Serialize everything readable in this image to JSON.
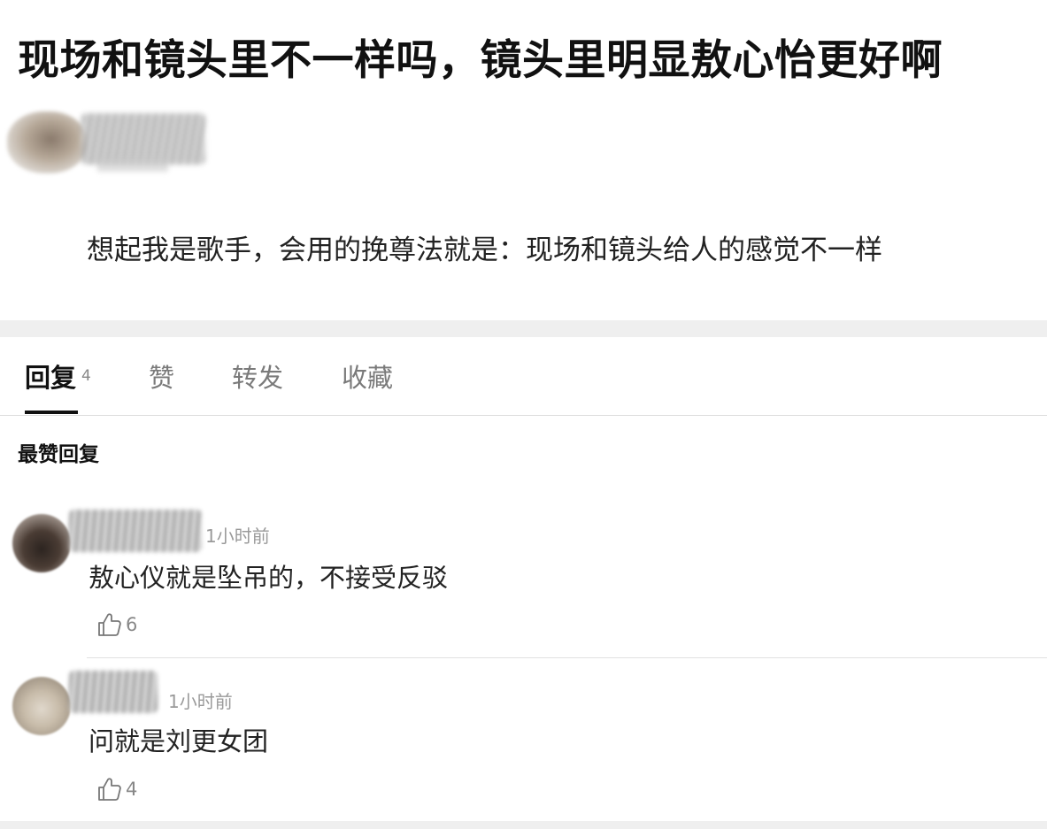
{
  "post": {
    "title": "现场和镜头里不一样吗，镜头里明显敖心怡更好啊",
    "body": "想起我是歌手，会用的挽尊法就是：现场和镜头给人的感觉不一样"
  },
  "tabs": [
    {
      "label": "回复",
      "count": "4",
      "active": true
    },
    {
      "label": "赞"
    },
    {
      "label": "转发"
    },
    {
      "label": "收藏"
    }
  ],
  "replies_section": {
    "header": "最赞回复",
    "items": [
      {
        "time": "1小时前",
        "text": "敖心仪就是坠吊的，不接受反驳",
        "likes": "6"
      },
      {
        "time": "1小时前",
        "text": "问就是刘更女团",
        "likes": "4"
      }
    ]
  },
  "icons": {
    "like": "thumbs-up-outline-icon"
  },
  "colors": {
    "text_primary": "#111111",
    "text_secondary": "#888888",
    "divider": "#efefef"
  }
}
